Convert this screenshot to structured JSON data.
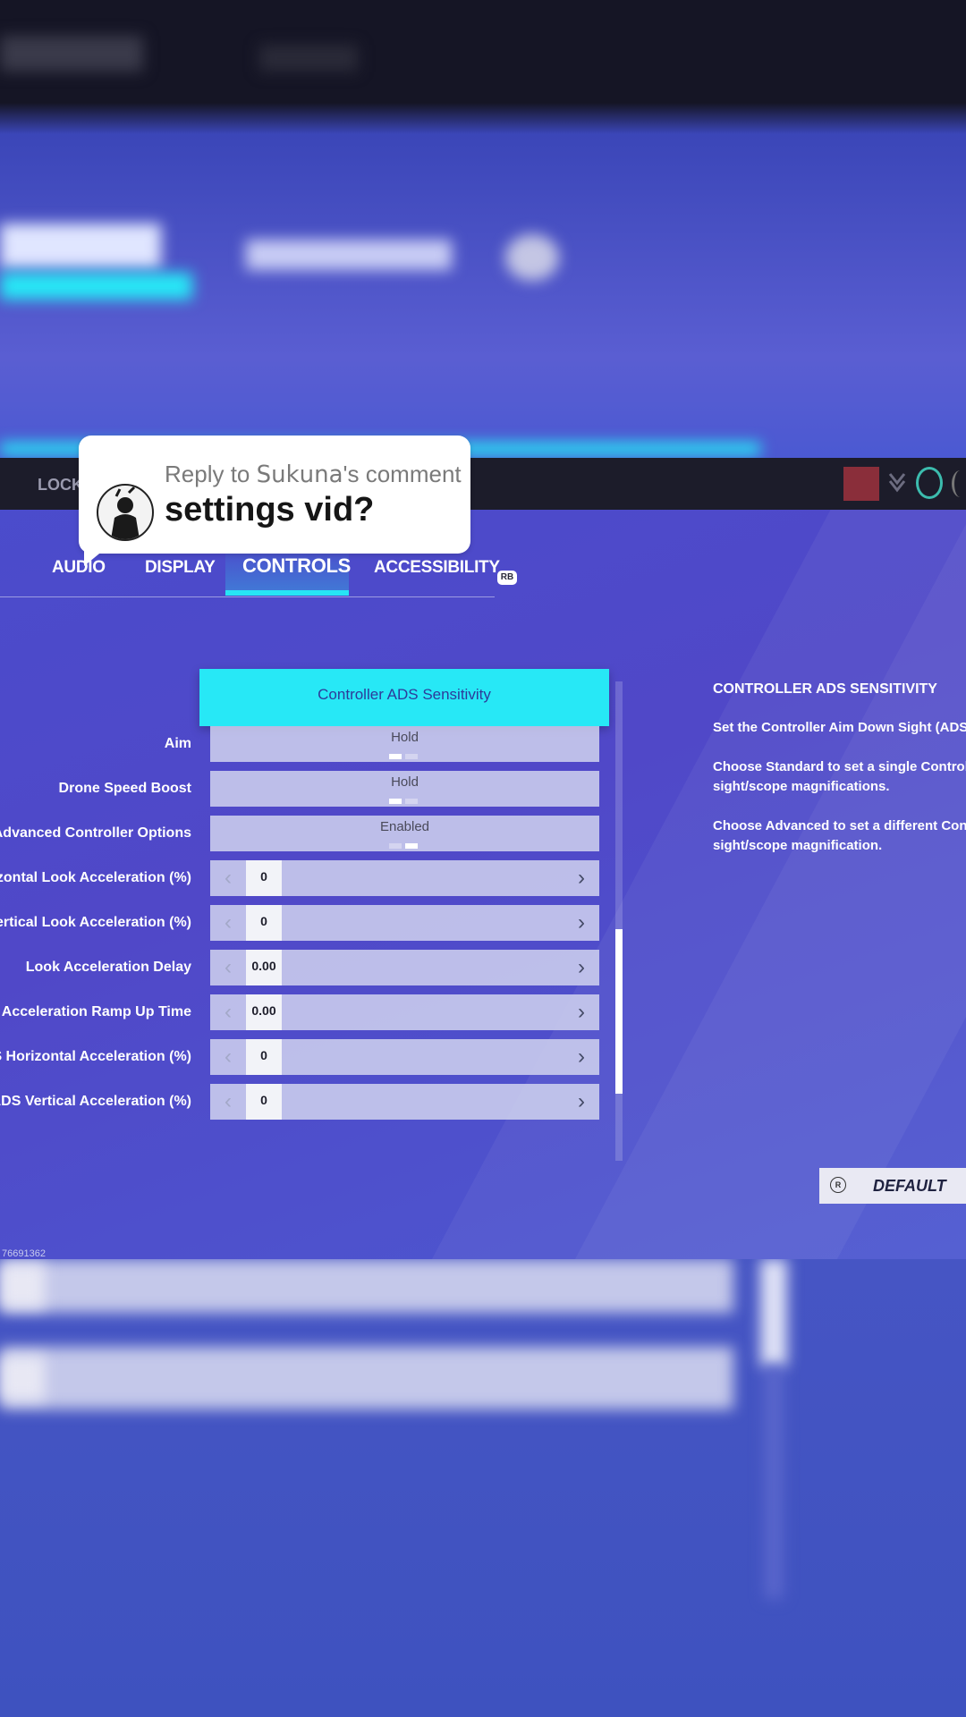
{
  "reply": {
    "header": "Reply to 𝖲𝗎𝗄𝗎𝗇𝖺's comment",
    "text": "settings vid?"
  },
  "top_bar": {
    "left_text": "LOCKE"
  },
  "tabs": [
    {
      "label": "AUDIO",
      "active": false
    },
    {
      "label": "DISPLAY",
      "active": false
    },
    {
      "label": "CONTROLS",
      "active": true
    },
    {
      "label": "ACCESSIBILITY",
      "active": false
    }
  ],
  "rb_badge": "RB",
  "highlight": {
    "label": "Controller ADS Sensitivity"
  },
  "settings": [
    {
      "label": "Aim",
      "type": "toggle",
      "value": "Hold"
    },
    {
      "label": "Drone Speed Boost",
      "type": "toggle",
      "value": "Hold"
    },
    {
      "label": "Advanced Controller Options",
      "type": "toggle",
      "value": "Enabled"
    },
    {
      "label": "Horizontal Look Acceleration (%)",
      "type": "stepper",
      "value": "0"
    },
    {
      "label": "Vertical Look Acceleration (%)",
      "type": "stepper",
      "value": "0"
    },
    {
      "label": "Look Acceleration Delay",
      "type": "stepper",
      "value": "0.00"
    },
    {
      "label": "Look Acceleration Ramp Up Time",
      "type": "stepper",
      "value": "0.00"
    },
    {
      "label": "ADS Horizontal Acceleration (%)",
      "type": "stepper",
      "value": "0"
    },
    {
      "label": "ADS Vertical Acceleration (%)",
      "type": "stepper",
      "value": "0"
    }
  ],
  "description": {
    "title": "CONTROLLER ADS SENSITIVITY",
    "line1": "Set the Controller Aim Down Sight (ADS) S",
    "line2a": "Choose Standard to set a single Controller",
    "line2b": "sight/scope magnifications.",
    "line3a": "Choose Advanced to set a different Contro",
    "line3b": "sight/scope magnification."
  },
  "default_button": {
    "label": "DEFAULT",
    "stick_glyph": "R"
  },
  "build_id": "76691362",
  "colors": {
    "accent_cyan": "#27e8f6",
    "background_blue": "#4a4ccc",
    "top_bar": "#1c1c2a"
  }
}
